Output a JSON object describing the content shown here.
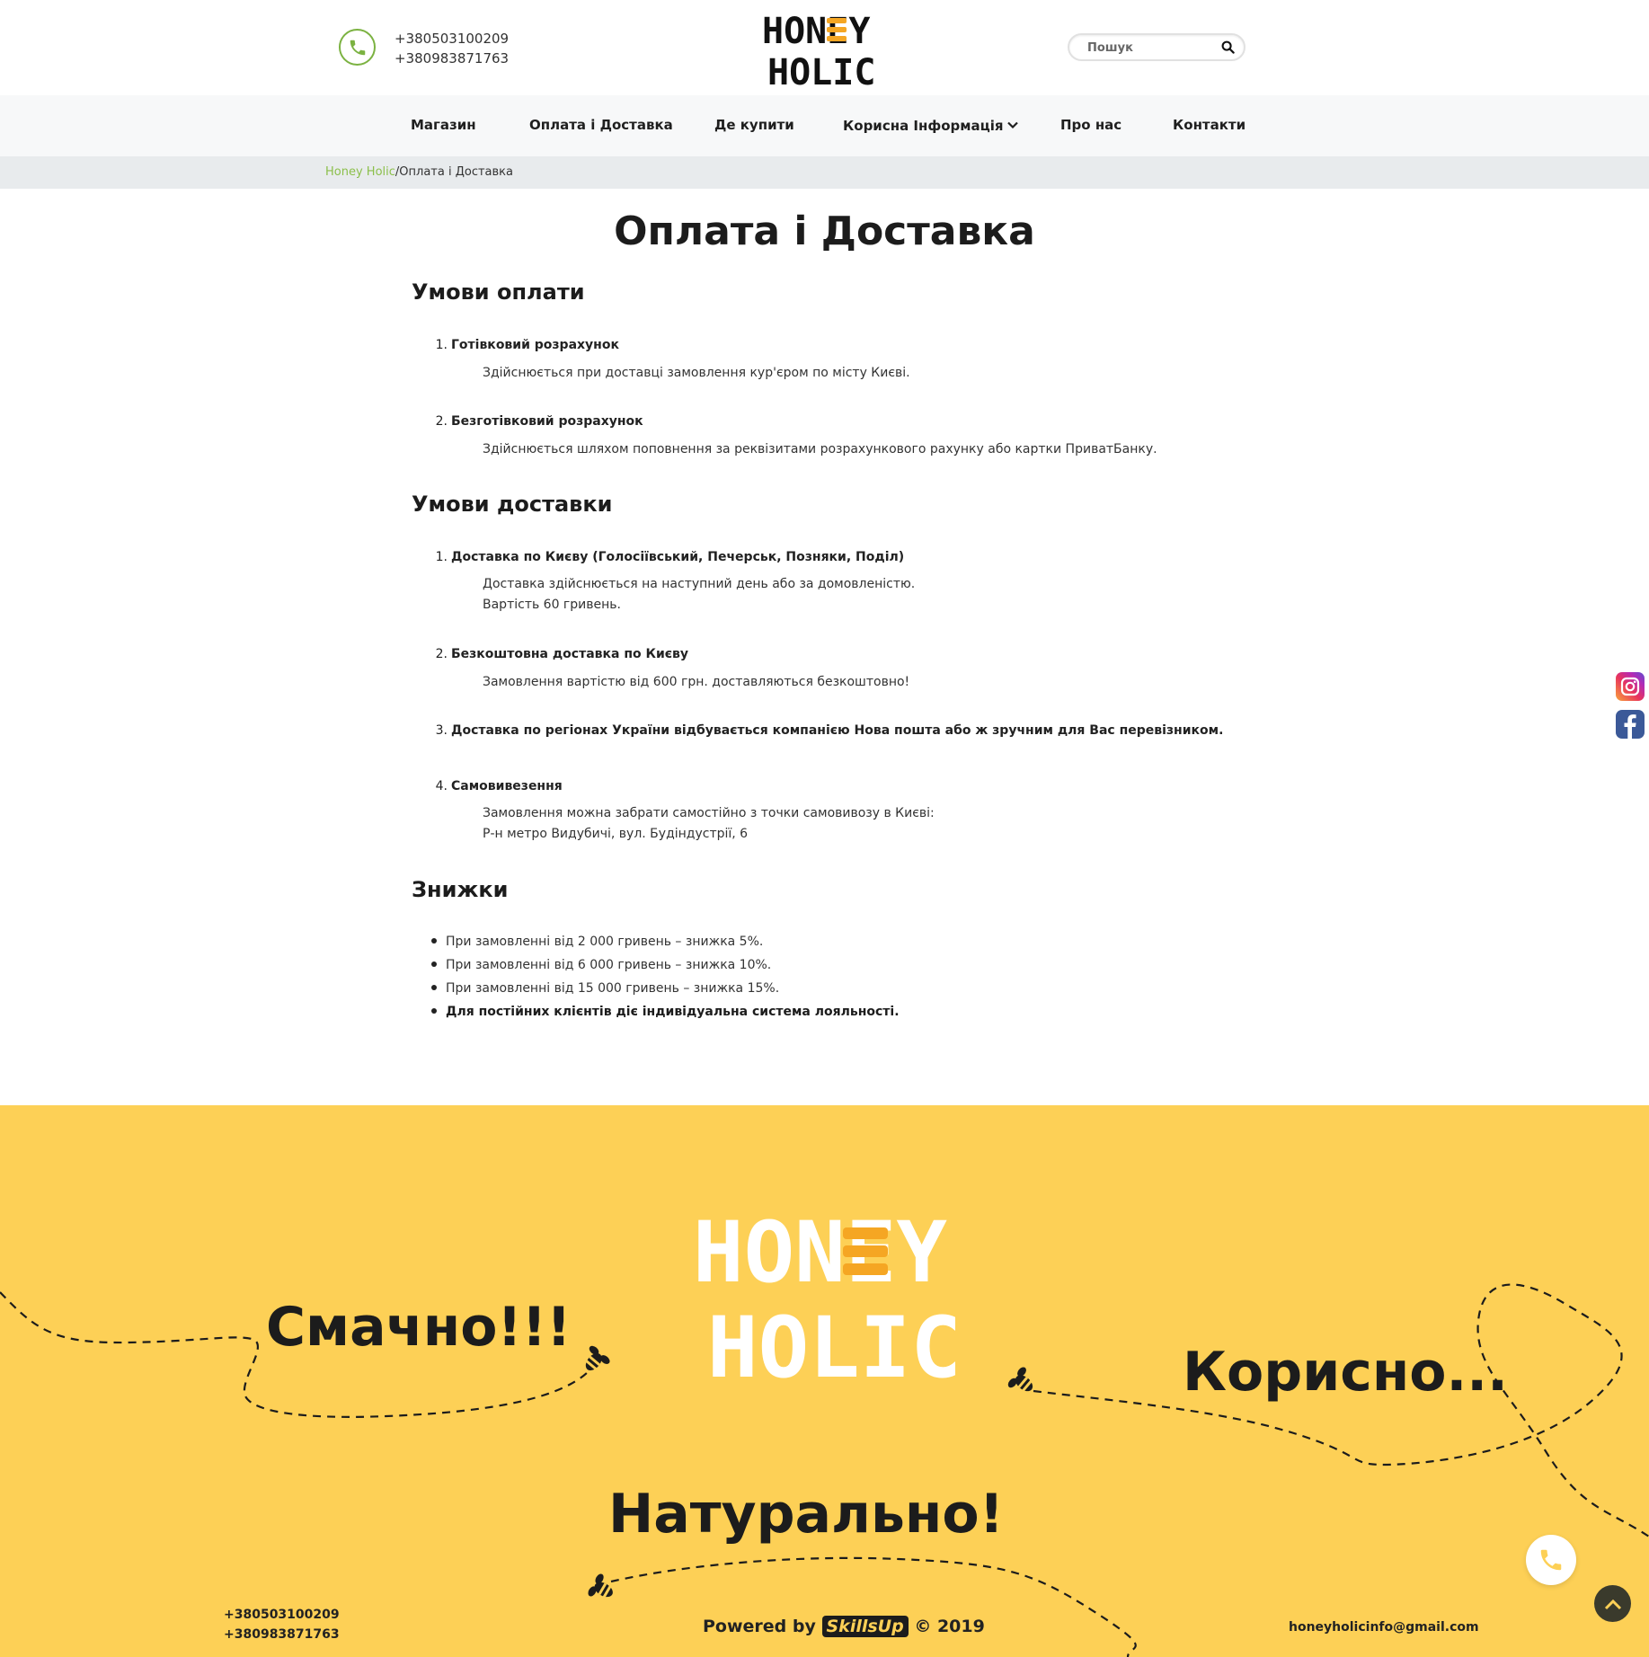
{
  "header": {
    "phones": [
      "+380503100209",
      "+380983871763"
    ],
    "logo_text": [
      "HONEY",
      "HOLIC"
    ],
    "search_placeholder": "Пошук"
  },
  "nav": {
    "items": [
      "Магазин",
      "Оплата і Доставка",
      "Де купити",
      "Корисна Інформація",
      "Про нас",
      "Контакти"
    ]
  },
  "breadcrumb": {
    "home": "Honey Holic",
    "separator": "/",
    "current": "Оплата і Доставка"
  },
  "content": {
    "title": "Оплата і Доставка",
    "payment": {
      "heading": "Умови оплати",
      "items": [
        {
          "num": "1.",
          "title": "Готівковий розрахунок",
          "lines": [
            "Здійснюється при доставці замовлення кур'єром по місту Києві."
          ]
        },
        {
          "num": "2.",
          "title": "Безготівковий розрахунок",
          "lines": [
            "Здійснюється шляхом поповнення за реквізитами розрахункового рахунку або картки ПриватБанку."
          ]
        }
      ]
    },
    "delivery": {
      "heading": "Умови доставки",
      "items": [
        {
          "num": "1.",
          "title": "Доставка по Києву (Голосіївський, Печерськ, Позняки, Поділ)",
          "lines": [
            "Доставка здійснюється на наступний день або за домовленістю.",
            "Вартість 60 гривень."
          ]
        },
        {
          "num": "2.",
          "title": "Безкоштовна доставка по Києву",
          "lines": [
            "Замовлення вартістю від 600 грн. доставляються безкоштовно!"
          ]
        },
        {
          "num": "3.",
          "title": "Доставка по регіонах України відбувається компанією Нова пошта або ж зручним для Вас перевізником.",
          "lines": []
        },
        {
          "num": "4.",
          "title": "Самовивезення",
          "lines": [
            "Замовлення можна забрати самостійно з точки самовивозу в Києві:",
            "Р-н метро Видубичі, вул. Будіндустрії, 6"
          ]
        }
      ]
    },
    "discounts": {
      "heading": "Знижки",
      "items": [
        "При замовленні від 2 000 гривень – знижка 5%.",
        "При замовленні від 6 000 гривень – знижка 10%.",
        "При замовленні від 15 000 гривень – знижка 15%.",
        "Для постійних клієнтів діє індивідуальна система лояльності."
      ]
    }
  },
  "footer": {
    "slogans": [
      "Смачно!!!",
      "Корисно...",
      "Натурально!"
    ],
    "phones": [
      "+380503100209",
      "+380983871763"
    ],
    "powered_prefix": "Powered by",
    "powered_brand": "SkillsUp",
    "powered_suffix": "© 2019",
    "email": "honeyholicinfo@gmail.com"
  },
  "colors": {
    "accent_green": "#7bb241",
    "footer_yellow": "#fdd056",
    "logo_orange": "#f5a623"
  },
  "icons": [
    "phone-icon",
    "search-icon",
    "chevron-down-icon",
    "instagram-icon",
    "facebook-icon",
    "bee-icon",
    "arrow-up-icon"
  ]
}
